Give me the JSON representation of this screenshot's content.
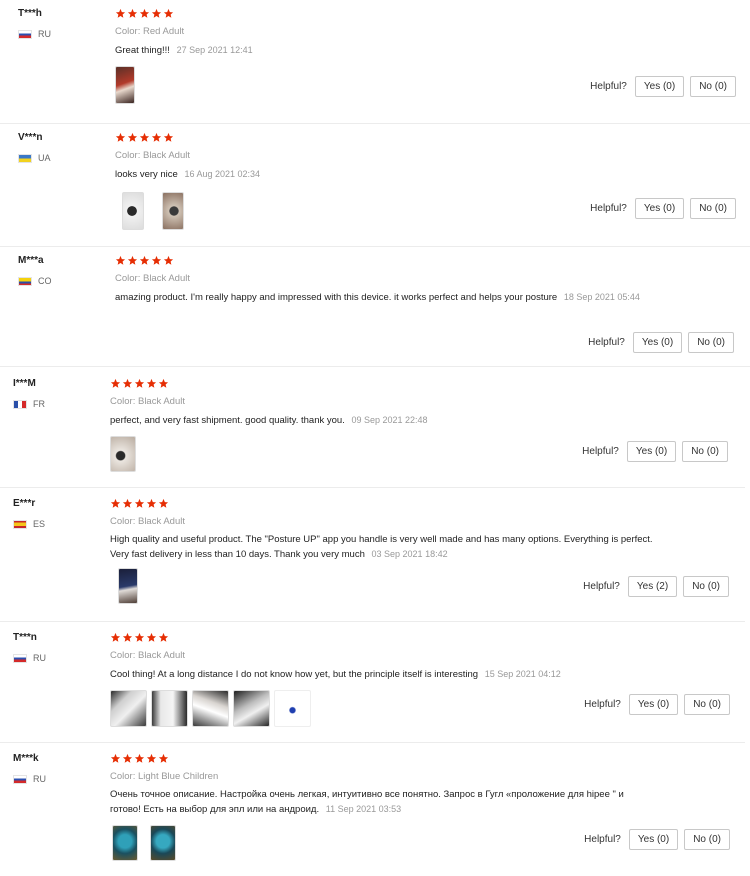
{
  "helpful_label": "Helpful?",
  "colors": {
    "star": "#e62e04",
    "muted": "#999999",
    "border": "#c8c8c8"
  },
  "reviews": [
    {
      "username": "T***h",
      "country": "RU",
      "flag": "russia-flag-icon",
      "color": "Color: Red Adult",
      "text": "Great thing!!!",
      "date": "27 Sep 2021 12:41",
      "yes": "Yes (0)",
      "no": "No (0)",
      "photos": 1
    },
    {
      "username": "V***n",
      "country": "UA",
      "flag": "ukraine-flag-icon",
      "color": "Color: Black Adult",
      "text": "looks very nice",
      "date": "16 Aug 2021 02:34",
      "yes": "Yes (0)",
      "no": "No (0)",
      "photos": 2
    },
    {
      "username": "M***a",
      "country": "CO",
      "flag": "colombia-flag-icon",
      "color": "Color: Black Adult",
      "text": "amazing product. I'm really happy and impressed with this device. it works perfect and helps your posture",
      "date": "18 Sep 2021 05:44",
      "yes": "Yes (0)",
      "no": "No (0)",
      "photos": 0
    },
    {
      "username": "I***M",
      "country": "FR",
      "flag": "france-flag-icon",
      "color": "Color: Black Adult",
      "text": "perfect, and very fast shipment. good quality. thank you.",
      "date": "09 Sep 2021 22:48",
      "yes": "Yes (0)",
      "no": "No (0)",
      "photos": 1
    },
    {
      "username": "E***r",
      "country": "ES",
      "flag": "spain-flag-icon",
      "color": "Color: Black Adult",
      "text": "High quality and useful product. The \"Posture UP\" app you handle is very well made and has many options. Everything is perfect. Very fast delivery in less than 10 days. Thank you very much",
      "date": "03 Sep 2021 18:42",
      "yes": "Yes (2)",
      "no": "No (0)",
      "photos": 1
    },
    {
      "username": "T***n",
      "country": "RU",
      "flag": "russia-flag-icon",
      "color": "Color: Black Adult",
      "text": "Cool thing! At a long distance I do not know how yet, but the principle itself is interesting",
      "date": "15 Sep 2021 04:12",
      "yes": "Yes (0)",
      "no": "No (0)",
      "photos": 5
    },
    {
      "username": "M***k",
      "country": "RU",
      "flag": "russia-flag-icon",
      "color": "Color: Light Blue Children",
      "text": "Очень точное описание. Настройка очень легкая, интуитивно все понятно. Запрос в Гугл «проложение для hipee \" и готово! Есть на выбор для эпл или на андроид.",
      "date": "11 Sep 2021 03:53",
      "yes": "Yes (0)",
      "no": "No (0)",
      "photos": 2
    }
  ]
}
